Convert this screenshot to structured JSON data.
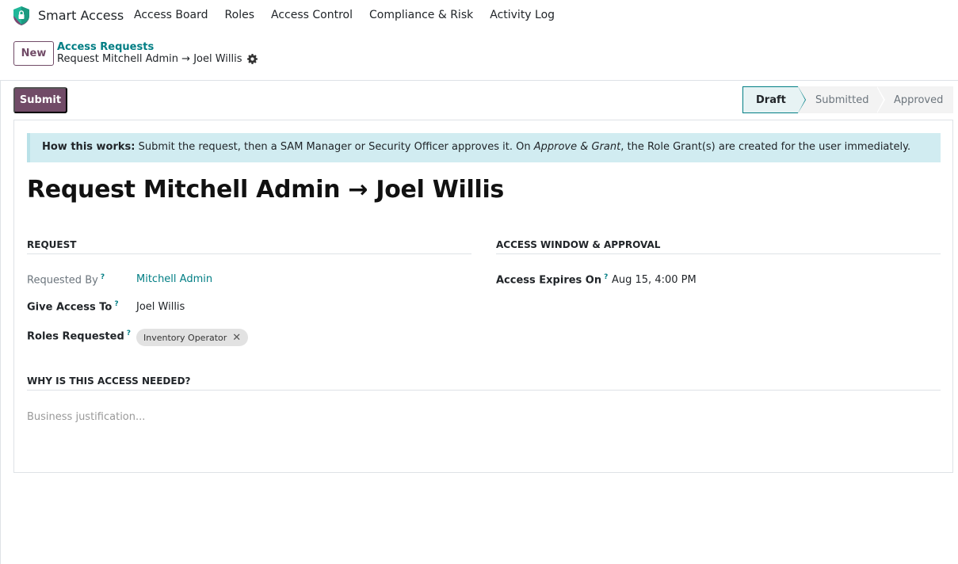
{
  "navbar": {
    "app_name": "Smart Access",
    "menu": [
      "Access Board",
      "Roles",
      "Access Control",
      "Compliance & Risk",
      "Activity Log"
    ]
  },
  "control_panel": {
    "new_label": "New",
    "breadcrumb_parent": "Access Requests",
    "breadcrumb_current": "Request Mitchell Admin → Joel Willis"
  },
  "actions": {
    "submit_label": "Submit"
  },
  "statusbar": {
    "steps": [
      "Draft",
      "Submitted",
      "Approved"
    ],
    "current": "Draft"
  },
  "alert": {
    "lead": "How this works:",
    "text_before": " Submit the request, then a SAM Manager or Security Officer approves it. On ",
    "emphasis": "Approve & Grant",
    "text_after": ", the Role Grant(s) are created for the user immediately."
  },
  "form": {
    "title": "Request Mitchell Admin → Joel Willis",
    "request_section": {
      "title": "REQUEST",
      "requested_by_label": "Requested By",
      "requested_by_value": "Mitchell Admin",
      "give_access_label": "Give Access To",
      "give_access_value": "Joel Willis",
      "roles_label": "Roles Requested",
      "roles": [
        "Inventory Operator"
      ]
    },
    "window_section": {
      "title": "ACCESS WINDOW & APPROVAL",
      "expires_label": "Access Expires On",
      "expires_value": "Aug 15, 4:00 PM"
    },
    "justification_section": {
      "title": "WHY IS THIS ACCESS NEEDED?",
      "placeholder": "Business justification..."
    },
    "help_marker": "?"
  },
  "colors": {
    "brand": "#714b67",
    "link": "#017e84",
    "alert_bg": "#d1ecf1"
  }
}
